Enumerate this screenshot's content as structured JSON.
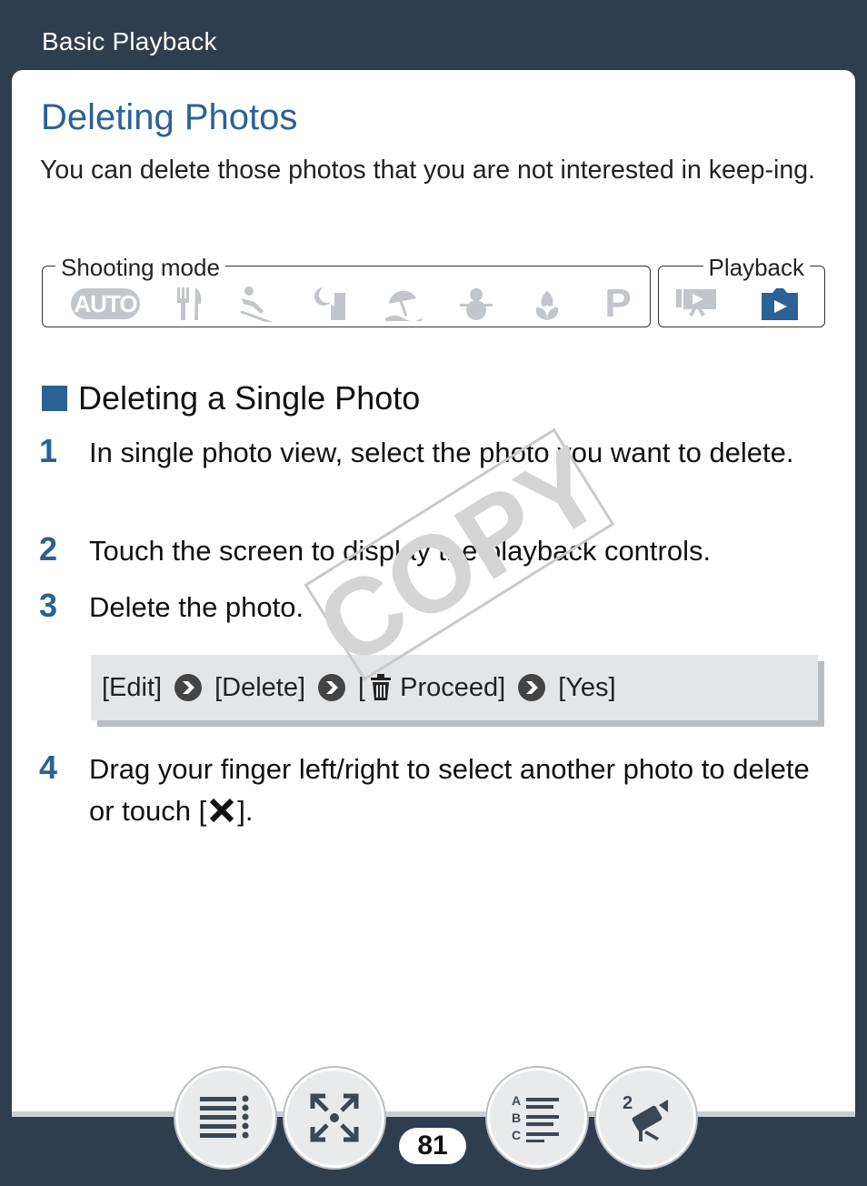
{
  "header": {
    "section": "Basic Playback"
  },
  "page": {
    "title": "Deleting Photos",
    "intro": "You can delete those photos that you are not interested in keep-ing."
  },
  "modes": {
    "shooting_label": "Shooting mode",
    "playback_label": "Playback",
    "auto_label": "AUTO",
    "program_label": "P"
  },
  "section": {
    "title": "Deleting a Single Photo"
  },
  "steps": [
    {
      "num": "1",
      "text": "In single photo view, select the photo you want to delete."
    },
    {
      "num": "2",
      "text": "Touch the screen to display the playback controls."
    },
    {
      "num": "3",
      "text": "Delete the photo."
    },
    {
      "num": "4",
      "text_before": "Drag your finger left/right to select another photo to delete or touch [",
      "text_after": "]."
    }
  ],
  "procedure": {
    "edit": "[Edit]",
    "delete": "[Delete]",
    "proceed_open": "[",
    "proceed": "Proceed]",
    "yes": "[Yes]"
  },
  "watermark": "COPY",
  "footer": {
    "page_number": "81",
    "index_letters": [
      "A",
      "B",
      "C"
    ],
    "mode_number": "2"
  },
  "colors": {
    "accent": "#2b6195",
    "background": "#2f3e4f",
    "inactive_icon": "#c2c6ca"
  }
}
